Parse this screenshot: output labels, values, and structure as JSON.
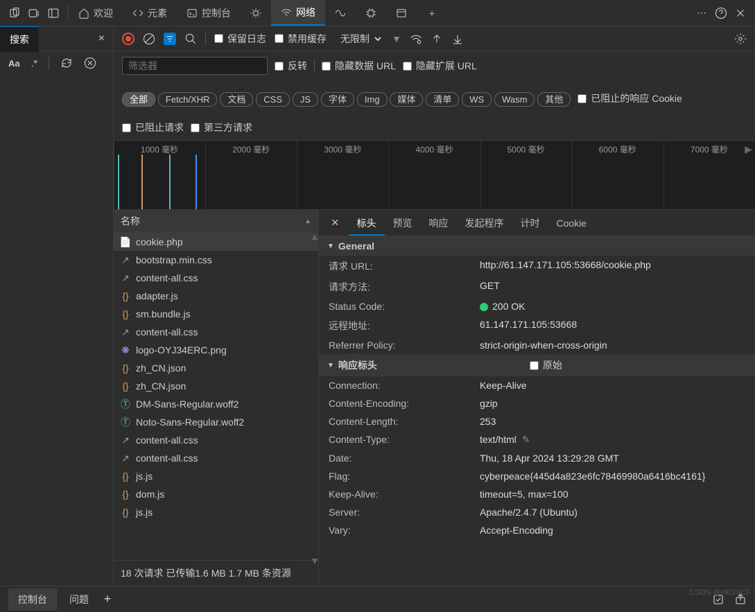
{
  "topbar": {
    "tabs": [
      {
        "icon": "home",
        "label": "欢迎"
      },
      {
        "icon": "code",
        "label": "元素"
      },
      {
        "icon": "console",
        "label": "控制台"
      },
      {
        "icon": "bug",
        "label": ""
      },
      {
        "icon": "wifi",
        "label": "网络",
        "active": true
      },
      {
        "icon": "perf",
        "label": ""
      },
      {
        "icon": "cpu",
        "label": ""
      },
      {
        "icon": "app",
        "label": ""
      }
    ]
  },
  "search": {
    "tab": "搜索"
  },
  "toolbar": {
    "preserve_log": "保留日志",
    "disable_cache": "禁用缓存",
    "throttle": "无限制"
  },
  "filterbar": {
    "placeholder": "筛选器",
    "invert": "反转",
    "hide_data": "隐藏数据 URL",
    "hide_ext": "隐藏扩展 URL",
    "types": [
      "全部",
      "Fetch/XHR",
      "文档",
      "CSS",
      "JS",
      "字体",
      "Img",
      "媒体",
      "清单",
      "WS",
      "Wasm",
      "其他"
    ],
    "blocked_cookie": "已阻止的响应 Cookie",
    "blocked_req": "已阻止请求",
    "thirdparty": "第三方请求"
  },
  "waterfall": {
    "ticks": [
      "1000 毫秒",
      "2000 毫秒",
      "3000 毫秒",
      "4000 毫秒",
      "5000 毫秒",
      "6000 毫秒",
      "7000 毫秒"
    ]
  },
  "list": {
    "header": "名称",
    "rows": [
      {
        "icon": "doc",
        "color": "#e9b35a",
        "name": "cookie.php",
        "sel": true
      },
      {
        "icon": "css",
        "color": "#c678dd",
        "name": "bootstrap.min.css"
      },
      {
        "icon": "css",
        "color": "#c678dd",
        "name": "content-all.css"
      },
      {
        "icon": "js",
        "color": "#d19a66",
        "name": "adapter.js"
      },
      {
        "icon": "js",
        "color": "#d19a66",
        "name": "sm.bundle.js"
      },
      {
        "icon": "css",
        "color": "#c678dd",
        "name": "content-all.css"
      },
      {
        "icon": "img",
        "color": "#a0a0ff",
        "name": "logo-OYJ34ERC.png"
      },
      {
        "icon": "json",
        "color": "#d19a66",
        "name": "zh_CN.json"
      },
      {
        "icon": "json",
        "color": "#d19a66",
        "name": "zh_CN.json"
      },
      {
        "icon": "font",
        "color": "#56b6c2",
        "name": "DM-Sans-Regular.woff2"
      },
      {
        "icon": "font",
        "color": "#56b6c2",
        "name": "Noto-Sans-Regular.woff2"
      },
      {
        "icon": "css",
        "color": "#c678dd",
        "name": "content-all.css"
      },
      {
        "icon": "css",
        "color": "#c678dd",
        "name": "content-all.css"
      },
      {
        "icon": "js",
        "color": "#d19a66",
        "name": "js.js"
      },
      {
        "icon": "js",
        "color": "#d19a66",
        "name": "dom.js"
      },
      {
        "icon": "js",
        "color": "#d19a66",
        "name": "js.js"
      }
    ],
    "status": "18 次请求  已传输1.6 MB   1.7 MB 条资源"
  },
  "detail": {
    "tabs": [
      "标头",
      "预览",
      "响应",
      "发起程序",
      "计时",
      "Cookie"
    ],
    "sections": {
      "general": {
        "title": "General",
        "kv": [
          {
            "k": "请求 URL:",
            "v": "http://61.147.171.105:53668/cookie.php"
          },
          {
            "k": "请求方法:",
            "v": "GET"
          },
          {
            "k": "Status Code:",
            "v": "200 OK",
            "status": true
          },
          {
            "k": "远程地址:",
            "v": "61.147.171.105:53668"
          },
          {
            "k": "Referrer Policy:",
            "v": "strict-origin-when-cross-origin"
          }
        ]
      },
      "response_hdr": {
        "title": "响应标头",
        "raw_label": "原始",
        "kv": [
          {
            "k": "Connection:",
            "v": "Keep-Alive"
          },
          {
            "k": "Content-Encoding:",
            "v": "gzip"
          },
          {
            "k": "Content-Length:",
            "v": "253"
          },
          {
            "k": "Content-Type:",
            "v": "text/html",
            "editable": true
          },
          {
            "k": "Date:",
            "v": "Thu, 18 Apr 2024 13:29:28 GMT"
          },
          {
            "k": "Flag:",
            "v": "cyberpeace{445d4a823e6fc78469980a6416bc4161}"
          },
          {
            "k": "Keep-Alive:",
            "v": "timeout=5, max=100"
          },
          {
            "k": "Server:",
            "v": "Apache/2.4.7 (Ubuntu)"
          },
          {
            "k": "Vary:",
            "v": "Accept-Encoding"
          }
        ]
      }
    }
  },
  "bottom": {
    "tabs": [
      "控制台",
      "问题"
    ]
  },
  "watermark": "CSDN @HEX9CF"
}
